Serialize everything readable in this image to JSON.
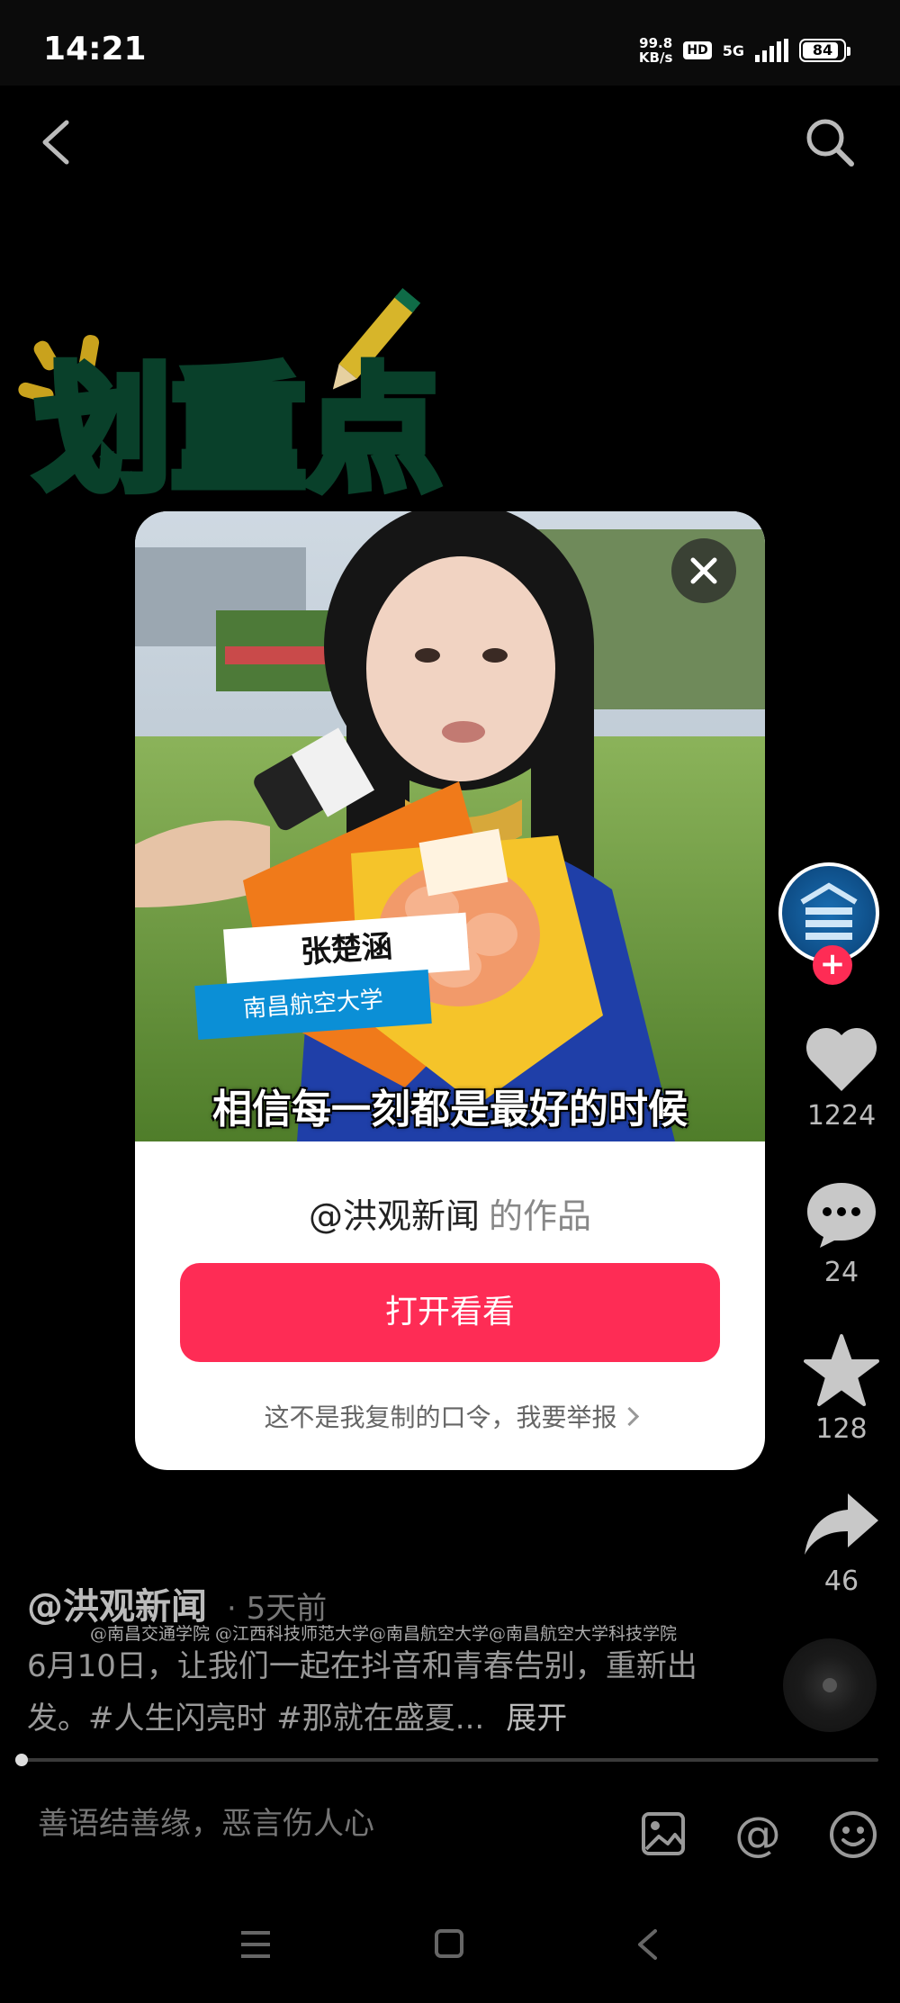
{
  "status_bar": {
    "time": "14:21",
    "net_speed_value": "99.8",
    "net_speed_unit": "KB/s",
    "hd": "HD",
    "network": "5G",
    "battery": "84"
  },
  "sticker_text": "划重点",
  "popup": {
    "person_name": "张楚涵",
    "school": "南昌航空大学",
    "caption": "相信每一刻都是最好的时候",
    "author": "@洪观新闻",
    "author_suffix": "的作品",
    "open_button": "打开看看",
    "report_text": "这不是我复制的口令，我要举报"
  },
  "actions": {
    "like_count": "1224",
    "comment_count": "24",
    "favorite_count": "128",
    "share_count": "46"
  },
  "post": {
    "author": "@洪观新闻",
    "time": "· 5天前",
    "watermark": "@南昌交通学院 @江西科技师范大学@南昌航空大学@南昌航空大学科技学院",
    "description": "6月10日，让我们一起在抖音和青春告别，重新出发。#人生闪亮时 #那就在盛夏...",
    "expand": "展开"
  },
  "comment_bar": {
    "placeholder": "善语结善缘，恶言伤人心"
  },
  "colors": {
    "accent": "#fe2c55",
    "background": "#000000",
    "popup_bg": "#ffffff"
  }
}
